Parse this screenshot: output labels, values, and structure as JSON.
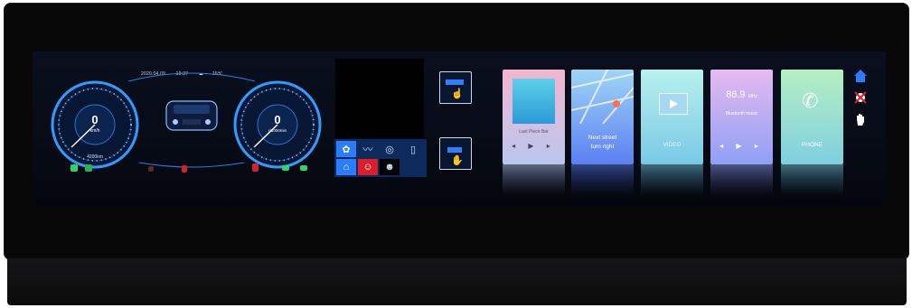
{
  "status": {
    "date": "2020.04.09",
    "time": "19:37",
    "weather": "16℃"
  },
  "speedometer": {
    "value": "0",
    "unit": "km/h",
    "odometer": "4200km"
  },
  "tachometer": {
    "value": "0",
    "unit": "r/1000min"
  },
  "media_cards": [
    {
      "id": "music",
      "title": "Last Piece Bar",
      "gradient": [
        "#f3b5cf",
        "#b9c7f0"
      ]
    },
    {
      "id": "navigation",
      "title_line1": "Next street",
      "title_line2": "turn right",
      "gradient": [
        "#9fd6f4",
        "#5c7ff2"
      ]
    },
    {
      "id": "video",
      "title": "VIDEO",
      "gradient": [
        "#b8f1ee",
        "#79c9e6"
      ]
    },
    {
      "id": "radio",
      "freq": "86.9",
      "freq_unit": "MHz",
      "subtitle": "Bluetooth music",
      "gradient": [
        "#e7b9f1",
        "#8fa0f4"
      ]
    },
    {
      "id": "phone",
      "title": "PHONE",
      "gradient": [
        "#b5efc2",
        "#7fcfe1"
      ]
    }
  ],
  "icons": {
    "home": "home-icon",
    "no_touch": "no-touch-icon",
    "hand": "hand-icon"
  },
  "colors": {
    "accent_blue": "#2b7cff",
    "gauge_glow": "#31a8ff",
    "alert_red": "#d8202a"
  }
}
